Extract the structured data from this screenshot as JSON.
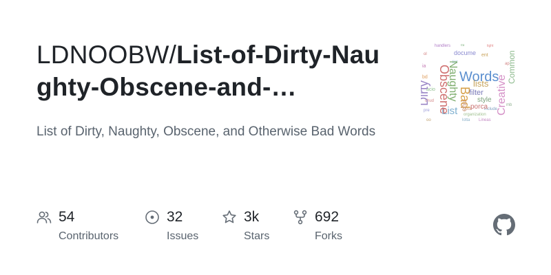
{
  "repo": {
    "owner": "LDNOOBW/",
    "name": "List-of-Dirty-Naughty-Obscene-and-…",
    "description": "List of Dirty, Naughty, Obscene, and Otherwise Bad Words"
  },
  "thumbnail": {
    "icon": "word-cloud-image",
    "words": [
      "Words",
      "Naughty",
      "Obscene",
      "Bad",
      "Dirty",
      "Creative",
      "Common",
      "List",
      "lists",
      "filter",
      "porca",
      "style",
      "document",
      "languages",
      "organizations"
    ]
  },
  "stats": [
    {
      "icon": "people-icon",
      "value": "54",
      "label": "Contributors"
    },
    {
      "icon": "issue-opened-icon",
      "value": "32",
      "label": "Issues"
    },
    {
      "icon": "star-icon",
      "value": "3k",
      "label": "Stars"
    },
    {
      "icon": "repo-forked-icon",
      "value": "692",
      "label": "Forks"
    }
  ],
  "brand": {
    "icon": "github-logo-icon"
  },
  "colors": {
    "text": "#1f2328",
    "muted": "#59636e",
    "icon": "#656d76",
    "logo": "#656d76"
  }
}
